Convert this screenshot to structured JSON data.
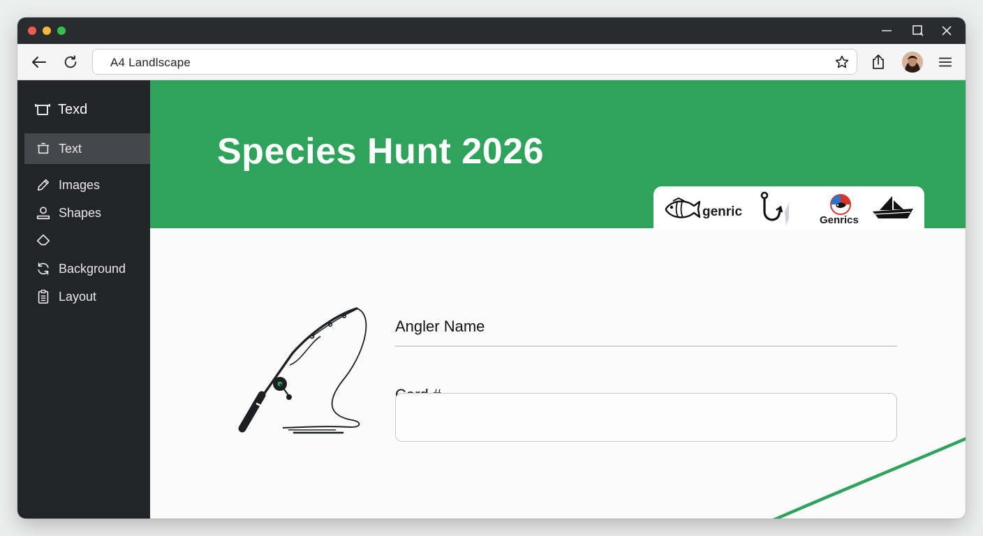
{
  "browser": {
    "address": "A4 Landlscape",
    "window_controls": [
      "minimize-icon",
      "maximize-icon",
      "close-icon"
    ],
    "toolbar_icons": [
      "back-arrow-icon",
      "reload-icon",
      "star-icon",
      "share-icon",
      "avatar",
      "menu-icon"
    ]
  },
  "sidebar": {
    "header": "Texd",
    "items": [
      {
        "label": "Text",
        "icon": "frame-icon",
        "active": true
      },
      {
        "label": "Images",
        "icon": "pencil-icon"
      },
      {
        "label": "Shapes",
        "icon": "person-icon"
      },
      {
        "label": "",
        "icon": "diamond-icon"
      },
      {
        "label": "Background",
        "icon": "refresh-icon"
      },
      {
        "label": "Layout",
        "icon": "clipboard-icon"
      }
    ]
  },
  "banner": {
    "title": "Species Hunt 2026",
    "logos": [
      {
        "icon": "fish-icon",
        "text": "genric"
      },
      {
        "icon": "hook-icon",
        "text": ""
      },
      {
        "icon": "round-emblem-icon",
        "text": "Genrics"
      },
      {
        "icon": "boat-icon",
        "text": ""
      }
    ]
  },
  "form": {
    "angler_label": "Angler Name",
    "card_label": "Card #",
    "angler_value": "",
    "card_value": ""
  },
  "colors": {
    "brand_green": "#2fa35c",
    "sidebar_bg": "#222428",
    "titlebar_bg": "#2a2b2f"
  }
}
